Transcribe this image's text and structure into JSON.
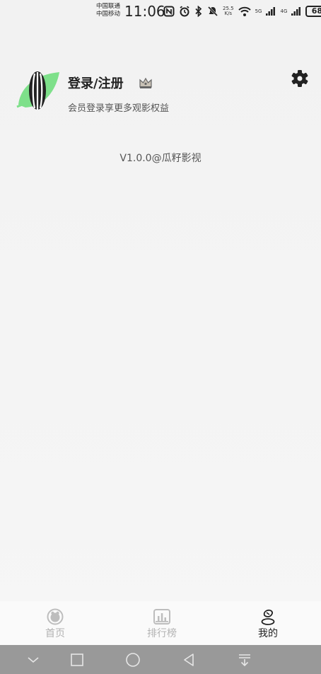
{
  "status_bar": {
    "carrier_1": "中国联通",
    "carrier_2": "中国移动",
    "time": "11:06",
    "net_speed_value": "25.5",
    "net_speed_unit": "K/s",
    "signal_1_label": "5G",
    "signal_2_label": "4G",
    "battery": "68"
  },
  "profile": {
    "title": "登录/注册",
    "subtitle": "会员登录享更多观影权益"
  },
  "version": "V1.0.0@瓜籽影视",
  "tabbar": {
    "items": [
      {
        "label": "首页",
        "icon": "home-icon",
        "active": false
      },
      {
        "label": "排行榜",
        "icon": "ranking-icon",
        "active": false
      },
      {
        "label": "我的",
        "icon": "profile-icon",
        "active": true
      }
    ]
  },
  "nav": {
    "icons": [
      "hide-keyboard-icon",
      "recents-icon",
      "home-circle-icon",
      "back-icon",
      "notification-shade-icon"
    ]
  },
  "colors": {
    "leaf_green": "#7ee08a",
    "inactive_tab": "#b3b3b3",
    "active_tab": "#222222",
    "nav_bar": "#999999"
  }
}
